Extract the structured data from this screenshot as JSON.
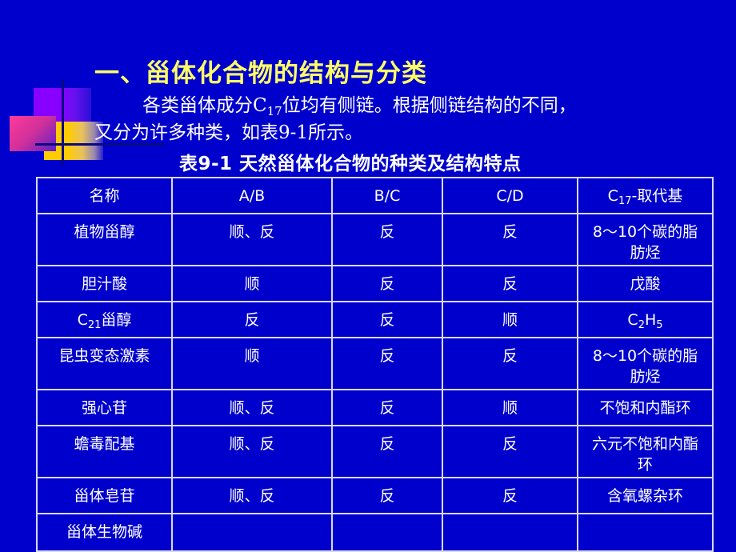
{
  "slide": {
    "title": "一、甾体化合物的结构与分类",
    "paragraph": {
      "line1_before": "各类甾体成分C",
      "line1_sub": "17",
      "line1_after": "位均有侧链。根据侧链结构的不同，",
      "line2": "又分为许多种类，如表9-1所示。"
    },
    "table_caption": "表9-1  天然甾体化合物的种类及结构特点",
    "colors": {
      "background": "#0000cc",
      "title": "#ffff66",
      "text": "#ffffff"
    }
  },
  "table": {
    "headers": {
      "name": "名称",
      "ab": "A/B",
      "bc": "B/C",
      "cd": "C/D",
      "c17_base": "C",
      "c17_sub": "17",
      "c17_after": "-取代基"
    },
    "rows": [
      {
        "name": "植物甾醇",
        "ab": "顺、反",
        "bc": "反",
        "cd": "反",
        "c17": "8～10个碳的脂肪烃"
      },
      {
        "name": "胆汁酸",
        "ab": "顺",
        "bc": "反",
        "cd": "反",
        "c17": "戊酸"
      },
      {
        "name_base": "C",
        "name_sub": "21",
        "name_after": "甾醇",
        "ab": "反",
        "bc": "反",
        "cd": "顺",
        "c17_base": "C",
        "c17_sub1": "2",
        "c17_mid": "H",
        "c17_sub2": "5"
      },
      {
        "name": "昆虫变态激素",
        "ab": "顺",
        "bc": "反",
        "cd": "反",
        "c17": "8～10个碳的脂肪烃"
      },
      {
        "name": "强心苷",
        "ab": "顺、反",
        "bc": "反",
        "cd": "顺",
        "c17": "不饱和内酯环"
      },
      {
        "name": "蟾毒配基",
        "ab": "顺、反",
        "bc": "反",
        "cd": "反",
        "c17": "六元不饱和内酯环"
      },
      {
        "name": "甾体皂苷",
        "ab": "顺、反",
        "bc": "反",
        "cd": "反",
        "c17": "含氧螺杂环"
      },
      {
        "name": "甾体生物碱",
        "ab": "",
        "bc": "",
        "cd": "",
        "c17": ""
      }
    ]
  }
}
